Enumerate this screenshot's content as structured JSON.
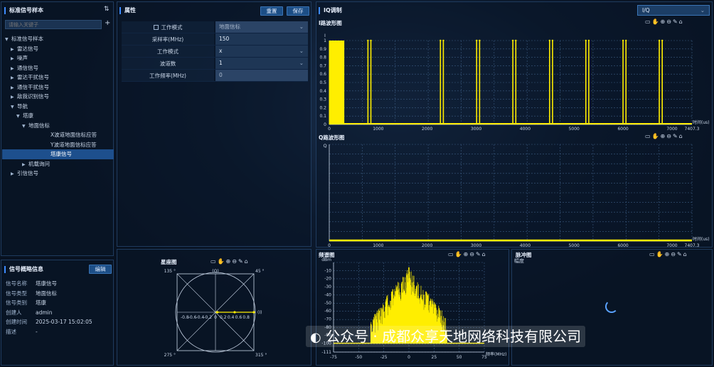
{
  "left": {
    "title": "标准信号样本",
    "search_placeholder": "请输入关键子",
    "tree": [
      {
        "label": "标准信号样本",
        "level": 0,
        "arrow": "down"
      },
      {
        "label": "雷达信号",
        "level": 1,
        "arrow": "right"
      },
      {
        "label": "噪声",
        "level": 1,
        "arrow": "right"
      },
      {
        "label": "通信信号",
        "level": 1,
        "arrow": "right"
      },
      {
        "label": "雷达干扰信号",
        "level": 1,
        "arrow": "right"
      },
      {
        "label": "通信干扰信号",
        "level": 1,
        "arrow": "right"
      },
      {
        "label": "敌我识别信号",
        "level": 1,
        "arrow": "right"
      },
      {
        "label": "导航",
        "level": 1,
        "arrow": "down"
      },
      {
        "label": "塔康",
        "level": 2,
        "arrow": "down"
      },
      {
        "label": "地面信标",
        "level": 3,
        "arrow": "down"
      },
      {
        "label": "X波道地面信标应答",
        "level": 4,
        "arrow": ""
      },
      {
        "label": "Y波道地面信标应答",
        "level": 4,
        "arrow": ""
      },
      {
        "label": "塔康信号",
        "level": 4,
        "arrow": "",
        "selected": true
      },
      {
        "label": "机载询问",
        "level": 3,
        "arrow": "right"
      },
      {
        "label": "引信信号",
        "level": 1,
        "arrow": "right"
      }
    ]
  },
  "info": {
    "title": "信号概略信息",
    "edit_label": "编辑",
    "rows": [
      {
        "k": "信号名称",
        "v": "塔康信号"
      },
      {
        "k": "信号类型",
        "v": "地面信标"
      },
      {
        "k": "信号类别",
        "v": "塔康"
      },
      {
        "k": "创建人",
        "v": "admin"
      },
      {
        "k": "创建时间",
        "v": "2025-03-17 15:02:05"
      },
      {
        "k": "描述",
        "v": "-"
      }
    ]
  },
  "props": {
    "title": "属性",
    "reset_label": "重置",
    "save_label": "保存",
    "rows": [
      {
        "label": "工作模式",
        "value": "地面信标",
        "dropdown": true,
        "checkbox": true,
        "disabled": true
      },
      {
        "label": "采样率(MHz)",
        "value": "150",
        "dropdown": false
      },
      {
        "label": "工作模式",
        "value": "x",
        "dropdown": true
      },
      {
        "label": "波道数",
        "value": "1",
        "dropdown": true
      },
      {
        "label": "工作频率(MHz)",
        "value": "0",
        "dropdown": false,
        "disabled": true
      }
    ]
  },
  "iq": {
    "title": "IQ调制",
    "select_value": "I/Q",
    "toolbar_icons": [
      "save-icon",
      "hand-icon",
      "zoom-in-icon",
      "zoom-out-icon",
      "pencil-icon",
      "home-icon"
    ]
  },
  "colors": {
    "accent": "#3d8bff",
    "trace": "#ffee00",
    "grid": "#4a6a8e",
    "panel_border": "#1f3b5e"
  },
  "watermark": "公众号 · 成都众享天地网络科技有限公司",
  "chart_data": [
    {
      "type": "line",
      "title": "I路波形图",
      "ylabel": "I",
      "xlabel": "时间(us)",
      "xlim": [
        0,
        7407.3
      ],
      "ylim": [
        0,
        1
      ],
      "x_ticks": [
        0,
        1000,
        2000,
        3000,
        4000,
        5000,
        6000,
        7000,
        7407.3
      ],
      "y_ticks": [
        0,
        0.1,
        0.2,
        0.3,
        0.4,
        0.5,
        0.6,
        0.7,
        0.8,
        0.9,
        1
      ],
      "dense_burst": [
        0,
        300
      ],
      "pulse_pairs": [
        790,
        2270,
        3010,
        3750,
        4500,
        5240,
        6000,
        6740
      ],
      "pulse_spacing": 60
    },
    {
      "type": "line",
      "title": "Q路波形图",
      "ylabel": "Q",
      "xlabel": "时间(us)",
      "xlim": [
        0,
        7407.3
      ],
      "ylim": [
        0,
        1
      ],
      "x_ticks": [
        0,
        1000,
        2000,
        3000,
        4000,
        5000,
        6000,
        7000,
        7407.3
      ],
      "values_constant": 0
    },
    {
      "type": "line",
      "title": "频谱图",
      "ylabel": "dBm",
      "xlabel": "频率(MHz)",
      "xlim": [
        -75,
        75
      ],
      "ylim": [
        -111,
        0
      ],
      "x_ticks": [
        -75,
        -50,
        -25,
        0,
        25,
        50,
        75
      ],
      "y_ticks": [
        -10,
        -20,
        -30,
        -40,
        -50,
        -60,
        -70,
        -80,
        -90,
        -100,
        -111
      ],
      "peaks": [
        {
          "x": -17,
          "y": -36
        },
        {
          "x": 0,
          "y": -6
        },
        {
          "x": 17,
          "y": -36
        }
      ],
      "floor": -100
    },
    {
      "type": "scatter",
      "title": "脉冲图",
      "ylabel": "幅度"
    },
    {
      "type": "scatter",
      "title": "星座图",
      "xlabel": "(I)",
      "ylabel": "(Q)",
      "angle_labels": [
        "135 °",
        "45 °",
        "275 °",
        "315 °"
      ],
      "x_ticks": [
        "-0.8",
        "-0.6",
        "-0.4",
        "-0.2",
        "0",
        "0.2",
        "0.4",
        "0.6",
        "0.8"
      ],
      "points": [
        {
          "i": 0.05,
          "q": 0
        },
        {
          "i": 0.5,
          "q": 0
        },
        {
          "i": 1,
          "q": 0
        }
      ]
    }
  ]
}
